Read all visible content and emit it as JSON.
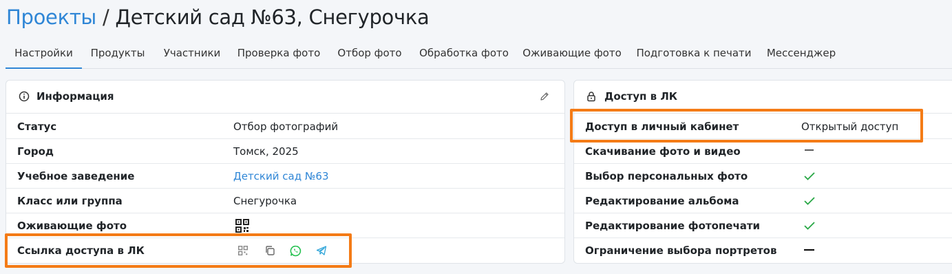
{
  "header": {
    "breadcrumb_link": "Проекты",
    "separator": "/",
    "title": "Детский сад №63, Снегурочка"
  },
  "tabs": [
    {
      "label": "Настройки",
      "active": true
    },
    {
      "label": "Продукты"
    },
    {
      "label": "Участники"
    },
    {
      "label": "Проверка фото"
    },
    {
      "label": "Отбор фото"
    },
    {
      "label": "Обработка фото"
    },
    {
      "label": "Оживающие фото"
    },
    {
      "label": "Подготовка к печати"
    },
    {
      "label": "Мессенджер"
    }
  ],
  "info": {
    "title": "Информация",
    "icons": {
      "header": "info-icon",
      "edit": "pencil-icon"
    },
    "rows": [
      {
        "label": "Статус",
        "value": "Отбор фотографий"
      },
      {
        "label": "Город",
        "value": "Томск, 2025"
      },
      {
        "label": "Учебное заведение",
        "value": "Детский сад №63"
      },
      {
        "label": "Класс или группа",
        "value": "Снегурочка"
      },
      {
        "label": "Оживающие фото",
        "value_icon": "qr-code-icon"
      },
      {
        "label": "Ссылка доступа в ЛК",
        "value_icons": [
          "qr-code-icon",
          "copy-icon",
          "whatsapp-icon",
          "telegram-icon"
        ]
      }
    ]
  },
  "access": {
    "title": "Доступ в ЛК",
    "icons": {
      "header": "lock-icon"
    },
    "rows": [
      {
        "label": "Доступ в личный кабинет",
        "value": "Открытый доступ"
      },
      {
        "label": "Скачивание фото и видео",
        "status": "dash"
      },
      {
        "label": "Выбор персональных фото",
        "status": "check"
      },
      {
        "label": "Редактирование альбома",
        "status": "check"
      },
      {
        "label": "Редактирование фотопечати",
        "status": "check"
      },
      {
        "label": "Ограничение выбора портретов",
        "status": "dash"
      }
    ]
  },
  "colors": {
    "accent": "#2f86d6",
    "check": "#28a745",
    "highlight": "#f47b16",
    "whatsapp": "#25c150",
    "telegram": "#2aa3d8"
  }
}
